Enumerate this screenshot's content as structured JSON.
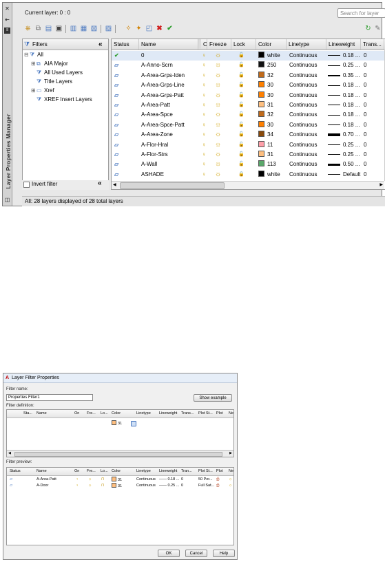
{
  "lpm": {
    "palette_title": "Layer Properties Manager",
    "current_layer": "Current layer: 0 : 0",
    "search_placeholder": "Search for layer",
    "filters_header": "Filters",
    "invert_filter_label": "Invert filter",
    "status_bar": "All: 28 layers displayed of 28 total layers",
    "tree": [
      {
        "label": "All",
        "level": 0,
        "icon": "filter-tree-icon"
      },
      {
        "label": "AIA Major",
        "level": 1,
        "icon": "group-filter-icon"
      },
      {
        "label": "All Used Layers",
        "level": 1,
        "icon": "property-filter-icon"
      },
      {
        "label": "Title Layers",
        "level": 1,
        "icon": "property-filter-icon"
      },
      {
        "label": "Xref",
        "level": 1,
        "icon": "xref-filter-icon"
      },
      {
        "label": "XREF Insert Layers",
        "level": 1,
        "icon": "property-filter-icon"
      }
    ],
    "columns": [
      "Status",
      "Name",
      "O...",
      "Freeze",
      "Lock",
      "Color",
      "Linetype",
      "Lineweight",
      "Trans..."
    ],
    "accent_current": "#2e9e2e",
    "layers": [
      {
        "status": "current",
        "name": "0",
        "color_name": "white",
        "color_hex": "#000000",
        "linetype": "Continuous",
        "lineweight": "0.18 ...",
        "lw_thick": 1,
        "trans": "0",
        "locked": false
      },
      {
        "status": "layer",
        "name": "A-Anno-Scrn",
        "color_name": "250",
        "color_hex": "#111111",
        "linetype": "Continuous",
        "lineweight": "0.25 ...",
        "lw_thick": 1,
        "trans": "0",
        "locked": false
      },
      {
        "status": "layer",
        "name": "A-Area-Grps-Iden",
        "color_name": "32",
        "color_hex": "#c06a1a",
        "linetype": "Continuous",
        "lineweight": "0.35 ...",
        "lw_thick": 2,
        "trans": "0",
        "locked": false
      },
      {
        "status": "layer",
        "name": "A-Area-Grps-Line",
        "color_name": "30",
        "color_hex": "#ff8000",
        "linetype": "Continuous",
        "lineweight": "0.18 ...",
        "lw_thick": 1,
        "trans": "0",
        "locked": false
      },
      {
        "status": "layer",
        "name": "A-Area-Grps-Patt",
        "color_name": "30",
        "color_hex": "#ff8000",
        "linetype": "Continuous",
        "lineweight": "0.18 ...",
        "lw_thick": 1,
        "trans": "0",
        "locked": false
      },
      {
        "status": "layer",
        "name": "A-Area-Patt",
        "color_name": "31",
        "color_hex": "#ffbf7f",
        "linetype": "Continuous",
        "lineweight": "0.18 ...",
        "lw_thick": 1,
        "trans": "0",
        "locked": false
      },
      {
        "status": "layer",
        "name": "A-Area-Spce",
        "color_name": "32",
        "color_hex": "#c06a1a",
        "linetype": "Continuous",
        "lineweight": "0.18 ...",
        "lw_thick": 1,
        "trans": "0",
        "locked": false
      },
      {
        "status": "layer",
        "name": "A-Area-Spce-Patt",
        "color_name": "30",
        "color_hex": "#ff8000",
        "linetype": "Continuous",
        "lineweight": "0.18 ...",
        "lw_thick": 1,
        "trans": "0",
        "locked": false
      },
      {
        "status": "layer",
        "name": "A-Area-Zone",
        "color_name": "34",
        "color_hex": "#8a4a0a",
        "linetype": "Continuous",
        "lineweight": "0.70 ...",
        "lw_thick": 4,
        "trans": "0",
        "locked": false
      },
      {
        "status": "layer",
        "name": "A-Flor-Hral",
        "color_name": "11",
        "color_hex": "#ff9fa8",
        "linetype": "Continuous",
        "lineweight": "0.25 ...",
        "lw_thick": 1,
        "trans": "0",
        "locked": false
      },
      {
        "status": "layer",
        "name": "A-Flor-Strs",
        "color_name": "31",
        "color_hex": "#ffbf7f",
        "linetype": "Continuous",
        "lineweight": "0.25 ...",
        "lw_thick": 1,
        "trans": "0",
        "locked": false
      },
      {
        "status": "layer",
        "name": "A-Wall",
        "color_name": "113",
        "color_hex": "#5aa86a",
        "linetype": "Continuous",
        "lineweight": "0.50 ...",
        "lw_thick": 3,
        "trans": "0",
        "locked": false
      },
      {
        "status": "layer",
        "name": "ASHADE",
        "color_name": "white",
        "color_hex": "#000000",
        "linetype": "Continuous",
        "lineweight": "Default",
        "lw_thick": 1,
        "trans": "0",
        "locked": true
      }
    ]
  },
  "dialog": {
    "title": "Layer Filter Properties",
    "filter_name_label": "Filter name:",
    "filter_name_value": "Properties Filter1",
    "show_example_label": "Show example",
    "filter_definition_label": "Filter definition:",
    "definition_columns": [
      "Sta...",
      "Name",
      "On",
      "Fre...",
      "Lo...",
      "Color",
      "Linetype",
      "Lineweight",
      "Trans...",
      "Plot St...",
      "Plot",
      "Ne"
    ],
    "definition_row": {
      "color": "31",
      "color_hex": "#ffbf7f"
    },
    "filter_preview_label": "Filter preview:",
    "preview_columns": [
      "Status",
      "Name",
      "On",
      "Fre...",
      "Lo...",
      "Color",
      "Linetype",
      "Lineweight",
      "Tran...",
      "Plot St...",
      "Plot",
      "Ne"
    ],
    "preview_rows": [
      {
        "name": "A-Area-Patt",
        "color": "31",
        "color_hex": "#ffbf7f",
        "linetype": "Continuous",
        "lineweight": "0.18 ...",
        "trans": "0",
        "plot_style": "50 Per..."
      },
      {
        "name": "A-Door",
        "color": "31",
        "color_hex": "#ffbf7f",
        "linetype": "Continuous",
        "lineweight": "0.25 ...",
        "trans": "0",
        "plot_style": "Full Sat..."
      }
    ],
    "ok_label": "OK",
    "cancel_label": "Cancel",
    "help_label": "Help"
  }
}
